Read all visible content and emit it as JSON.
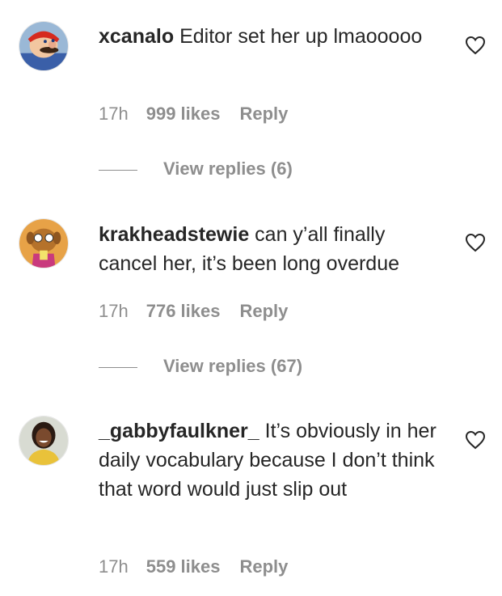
{
  "comments": [
    {
      "username": "xcanalo",
      "text": "Editor set her up lmaooooo",
      "time": "17h",
      "likes": "999 likes",
      "reply": "Reply",
      "view_replies": "View replies (6)",
      "avatar_icon": "mario-avatar"
    },
    {
      "username": "krakheadstewie",
      "text": "can y’all finally cancel her, it’s been long overdue",
      "time": "17h",
      "likes": "776 likes",
      "reply": "Reply",
      "view_replies": "View replies (67)",
      "avatar_icon": "cartoon-character-avatar"
    },
    {
      "username": "_gabbyfaulkner_",
      "text": "It’s obviously in her daily vocabulary because I don’t think that word would just slip out",
      "time": "17h",
      "likes": "559 likes",
      "reply": "Reply",
      "avatar_icon": "person-avatar"
    }
  ],
  "colors": {
    "text": "#262626",
    "secondary": "#8e8e8e",
    "background": "#ffffff"
  }
}
